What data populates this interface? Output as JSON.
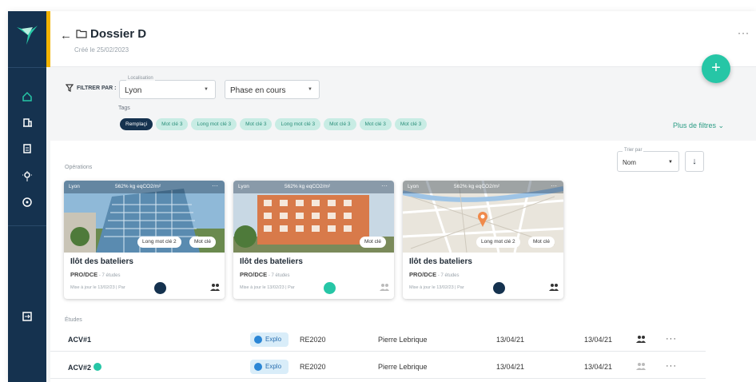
{
  "colors": {
    "sidebar": "#15324f",
    "accent": "#f4b400",
    "primary": "#26c6a6",
    "tag_bg": "#c8ece4",
    "link": "#2a9c84"
  },
  "sidebar": {
    "icons": [
      "logo-bird",
      "home-icon",
      "building-icon",
      "document-icon",
      "lightbulb-icon",
      "help-icon",
      "logout-icon"
    ]
  },
  "header": {
    "back": "←",
    "title": "Dossier D",
    "subtitle": "Créé le 25/02/2023",
    "more": "···",
    "fab": "+"
  },
  "filters": {
    "label": "FILTRER PAR :",
    "location_label": "Localisation",
    "location_value": "Lyon",
    "phase_value": "Phase en cours",
    "tags_label": "Tags",
    "tags": [
      "Remplaçi",
      "Mot clé 3",
      "Long mot clé 3",
      "Mot clé 3",
      "Long mot clé 3",
      "Mot clé 3",
      "Mot clé 3",
      "Mot clé 3"
    ],
    "more_filters": "Plus de filtres ⌄"
  },
  "operations": {
    "label": "Opérations",
    "sort_label": "Trier par",
    "sort_value": "Nom",
    "sort_dir": "↓"
  },
  "cards": [
    {
      "location": "Lyon",
      "co2": "562% kg eqCO2/m²",
      "chips": [
        "Long mot clé 2",
        "Mot clé"
      ],
      "name": "Ilôt des bateliers",
      "phase": "PRO/DCE",
      "studies": " - 7 études",
      "updated": "Mise à jour le 13/02/23  |  Par"
    },
    {
      "location": "Lyon",
      "co2": "562% kg eqCO2/m²",
      "chips": [
        "Mot clé"
      ],
      "name": "Ilôt des bateliers",
      "phase": "PRO/DCE",
      "studies": " - 7 études",
      "updated": "Mise à jour le 13/02/23  |  Par"
    },
    {
      "location": "Lyon",
      "co2": "562% kg eqCO2/m²",
      "chips": [
        "Long mot clé 2",
        "Mot clé"
      ],
      "name": "Ilôt des bateliers",
      "phase": "PRO/DCE",
      "studies": " - 7 études",
      "updated": "Mise à jour le 13/02/23  |  Par"
    }
  ],
  "studies": {
    "label": "Études",
    "rows": [
      {
        "name": "ACV#1",
        "badge": "Explo",
        "norm": "RE2020",
        "person": "Pierre Lebrique",
        "date1": "13/04/21",
        "date2": "13/04/21",
        "more": "···"
      },
      {
        "name": "ACV#2",
        "badge": "Explo",
        "norm": "RE2020",
        "person": "Pierre Lebrique",
        "date1": "13/04/21",
        "date2": "13/04/21",
        "more": "···"
      }
    ]
  }
}
